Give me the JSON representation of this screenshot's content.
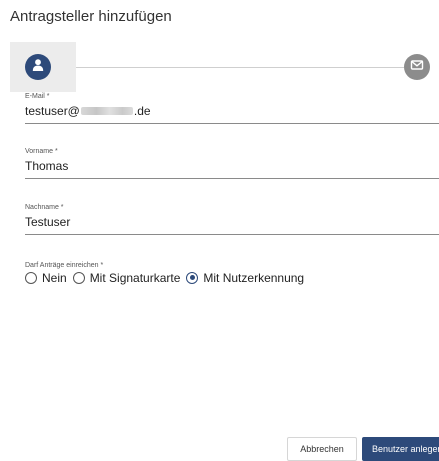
{
  "dialog": {
    "title": "Antragsteller hinzufügen"
  },
  "stepper": {
    "steps": [
      {
        "icon": "user-icon",
        "active": true
      },
      {
        "icon": "envelope-icon",
        "active": false
      }
    ]
  },
  "form": {
    "email": {
      "label": "E-Mail *",
      "value_prefix": "testuser@",
      "value_suffix": ".de"
    },
    "firstname": {
      "label": "Vorname *",
      "value": "Thomas"
    },
    "lastname": {
      "label": "Nachname *",
      "value": "Testuser"
    },
    "permission": {
      "label": "Darf Anträge einreichen *",
      "options": [
        {
          "label": "Nein",
          "checked": false
        },
        {
          "label": "Mit Signaturkarte",
          "checked": false
        },
        {
          "label": "Mit Nutzerkennung",
          "checked": true
        }
      ]
    }
  },
  "buttons": {
    "cancel": "Abbrechen",
    "create": "Benutzer anlegen"
  },
  "colors": {
    "primary": "#2d4a7a",
    "inactive_step": "#8c8c8c",
    "step_highlight": "#ececec"
  }
}
